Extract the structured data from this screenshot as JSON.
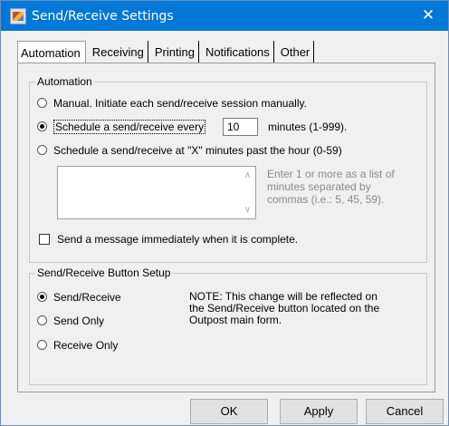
{
  "window": {
    "title": "Send/Receive Settings",
    "close_glyph": "✕"
  },
  "tabs": [
    {
      "label": "Automation",
      "active": true
    },
    {
      "label": "Receiving"
    },
    {
      "label": "Printing"
    },
    {
      "label": "Notifications"
    },
    {
      "label": "Other"
    }
  ],
  "automation": {
    "group_label": "Automation",
    "manual_label": "Manual.  Initiate each send/receive session manually.",
    "schedule_every_label": "Schedule a send/receive every",
    "minutes_value": "10",
    "minutes_suffix": "minutes (1-999).",
    "schedule_past_label": "Schedule a send/receive at \"X\" minutes past the hour (0-59)",
    "minutes_list_value": "",
    "hint_line1": "Enter 1 or more as a list of",
    "hint_line2": "minutes separated by",
    "hint_line3": "commas   (i.e.: 5, 45, 59).",
    "send_immediately_label": "Send a message immediately when it is complete."
  },
  "button_setup": {
    "group_label": "Send/Receive Button Setup",
    "send_receive_label": "Send/Receive",
    "send_only_label": "Send Only",
    "receive_only_label": "Receive Only",
    "note_line1": "NOTE:  This change will be reflected on",
    "note_line2": "the Send/Receive button located on the",
    "note_line3": "Outpost main form."
  },
  "footer": {
    "ok_label": "OK",
    "apply_label": "Apply",
    "cancel_label": "Cancel"
  },
  "colors": {
    "titlebar": "#0078d7",
    "dialog_bg": "#f0f0f0"
  }
}
